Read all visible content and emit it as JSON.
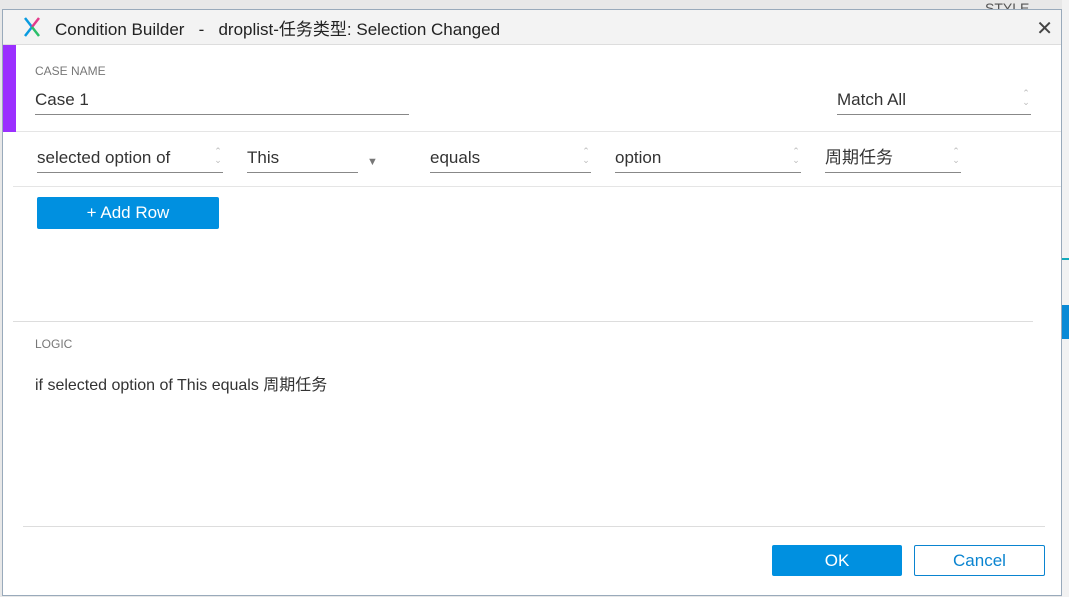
{
  "background": {
    "partial_text": "STYLE"
  },
  "dialog": {
    "title": "Condition Builder   -   droplist-任务类型: Selection Changed",
    "case_name_label": "CASE NAME",
    "case_name_value": "Case 1",
    "match_mode": "Match All",
    "condition_row": {
      "subject": "selected option of",
      "target": "This",
      "operator": "equals",
      "value_type": "option",
      "value": "周期任务"
    },
    "add_row_label": "+ Add Row",
    "logic_label": "LOGIC",
    "logic_text": "if selected option of This equals 周期任务",
    "ok_label": "OK",
    "cancel_label": "Cancel"
  },
  "colors": {
    "accent": "#9b30ff",
    "primary": "#0090e0"
  }
}
